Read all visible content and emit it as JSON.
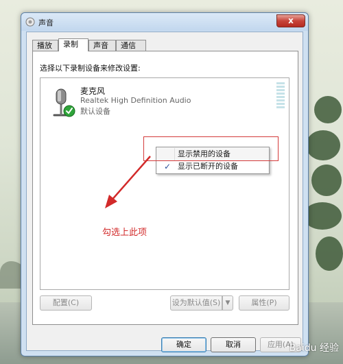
{
  "window": {
    "title": "声音",
    "close_label": "x"
  },
  "tabs": [
    {
      "label": "播放",
      "active": false
    },
    {
      "label": "录制",
      "active": true
    },
    {
      "label": "声音",
      "active": false
    },
    {
      "label": "通信",
      "active": false
    }
  ],
  "panel": {
    "instruction": "选择以下录制设备来修改设置:"
  },
  "device": {
    "name": "麦克风",
    "driver": "Realtek High Definition Audio",
    "status": "默认设备",
    "icon": "microphone-icon"
  },
  "context_menu": {
    "items": [
      {
        "label": "显示禁用的设备",
        "checked": false
      },
      {
        "label": "显示已断开的设备",
        "checked": true
      }
    ],
    "check_glyph": "✓"
  },
  "annotation": {
    "text": "勾选上此项",
    "color": "#d22a2a"
  },
  "buttons": {
    "configure": "配置(C)",
    "set_default": "设为默认值(S)",
    "properties": "属性(P)",
    "ok": "确定",
    "cancel": "取消",
    "apply": "应用(A)"
  },
  "watermark": "Baidu 经验",
  "colors": {
    "accent": "#3c7fb1",
    "close": "#c7443a",
    "highlight": "#d43a3a",
    "check": "#2a4f9b"
  }
}
